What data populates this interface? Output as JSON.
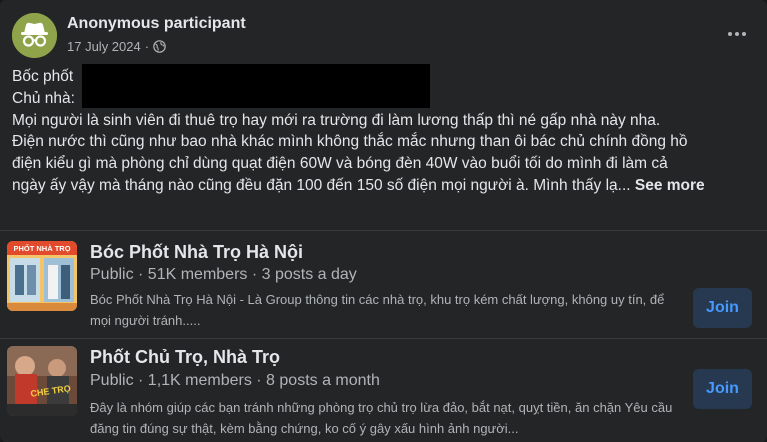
{
  "post": {
    "author": "Anonymous participant",
    "date": "17 July 2024",
    "separator": "·",
    "lines": {
      "line1": "Bốc phốt",
      "line2": "Chủ nhà:",
      "line3": "Mọi người là sinh viên đi thuê trọ hay mới ra trường đi làm lương thấp thì né gấp nhà này nha.",
      "line4": "Điện nước thì cũng như bao nhà khác mình không thắc mắc nhưng than ôi bác chủ chính đồng hồ",
      "line5": "điện kiểu gì mà phòng chỉ dùng quạt điện 60W và bóng đèn 40W vào buổi tối do mình đi làm cả",
      "line6": "ngày ấy vậy mà tháng nào cũng đều đặn 100 đến 150 số điện mọi người à. Mình thấy lạ...",
      "see_more": "See more"
    },
    "icons": {
      "avatar": "incognito-avatar-icon",
      "privacy": "globe-icon",
      "options": "more-options-icon"
    }
  },
  "groups": [
    {
      "name": "Bóc Phốt Nhà Trọ Hà Nội",
      "info": "Public · 51K members · 3 posts a day",
      "description": "Bóc Phốt Nhà Trọ Hà Nội - Là Group thông tin các nhà trọ, khu trọ kém chất lượng, không uy tín, để mọi người tránh.....",
      "join_label": "Join"
    },
    {
      "name": "Phốt Chủ Trọ, Nhà Trọ",
      "info": "Public · 1,1K members · 8 posts a month",
      "description": "Đây là nhóm giúp các bạn tránh những phòng trọ chủ trọ lừa đảo, bắt nạt, quỵt tiền, ăn chặn Yêu cầu đăng tin đúng sự thật, kèm bằng chứng, ko cố ý gây xấu hình ảnh người...",
      "join_label": "Join"
    }
  ],
  "colors": {
    "background": "#242526",
    "text_primary": "#e4e6eb",
    "text_secondary": "#b0b3b8",
    "join_bg": "#263951",
    "join_text": "#4599ff",
    "avatar_green": "#8ea34a"
  }
}
